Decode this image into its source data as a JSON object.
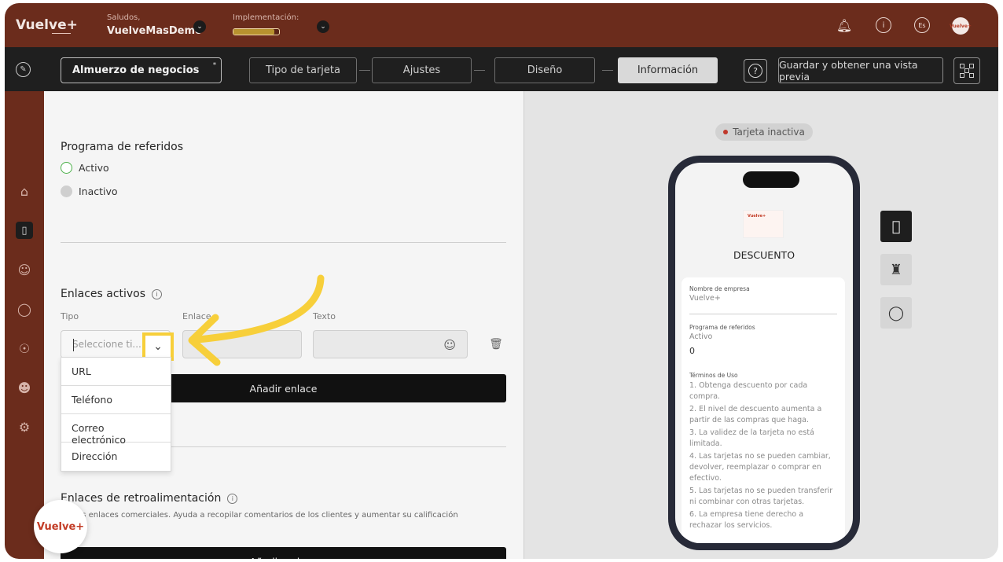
{
  "header": {
    "brand": "Vuelve+",
    "greeting_small": "Saludos,",
    "greeting_name": "VuelveMasDemo",
    "implementation_label": "Implementación:",
    "implementation_progress": 0.9,
    "language_badge": "Es",
    "avatar_text": "Vuelve+"
  },
  "toolbar": {
    "card_name": "Almuerzo de negocios",
    "card_name_marker": "*",
    "steps": [
      "Tipo de tarjeta",
      "Ajustes",
      "Diseño",
      "Información"
    ],
    "active_step": "Información",
    "help_label": "?",
    "save_label": "Guardar y obtener una vista previa"
  },
  "sidebar": {
    "icons": [
      "home-icon",
      "card-icon",
      "users-icon",
      "chat-icon",
      "location-icon",
      "user-icon",
      "settings-icon"
    ]
  },
  "referidos": {
    "title": "Programa de referidos",
    "options": [
      {
        "label": "Activo",
        "selected": true
      },
      {
        "label": "Inactivo",
        "selected": false
      }
    ]
  },
  "enlaces": {
    "title": "Enlaces activos",
    "info_glyph": "i",
    "col_tipo": "Tipo",
    "col_enlace": "Enlace",
    "col_texto": "Texto",
    "tipo_placeholder": "Seleccione ti...",
    "dropdown_options": [
      "URL",
      "Teléfono",
      "Correo electrónico",
      "Dirección"
    ],
    "add_label": "Añadir enlace"
  },
  "retro": {
    "title": "Enlaces de retroalimentación",
    "description": "ue sus enlaces comerciales. Ayuda a recopilar comentarios de los clientes y aumentar su calificación",
    "add_label": "Añadir enlace"
  },
  "preview": {
    "status": "Tarjeta inactiva",
    "status_color": "#c0382b",
    "mini_logo": "Vuelve+",
    "card_type": "DESCUENTO",
    "company_label": "Nombre de empresa",
    "company_value": "Vuelve+",
    "referral_label": "Programa de referidos",
    "referral_value": "Activo",
    "referral_count": "0",
    "terms_label": "Términos de Uso",
    "terms": [
      "1. Obtenga descuento por cada compra.",
      "2. El nivel de descuento aumenta a partir de las compras que haga.",
      "3. La validez de la tarjeta no está limitada.",
      "4. Las tarjetas no se pueden cambiar, devolver, reemplazar o comprar en efectivo.",
      "5. Las tarjetas no se pueden transferir ni combinar con otras tarjetas.",
      "6. La empresa tiene derecho a rechazar los servicios."
    ]
  },
  "floating_logo": "Vuelve+",
  "colors": {
    "brand": "#6b2c1c",
    "dark": "#1f1f1f",
    "highlight": "#f7cf3a",
    "active_radio": "#4cb04a"
  }
}
